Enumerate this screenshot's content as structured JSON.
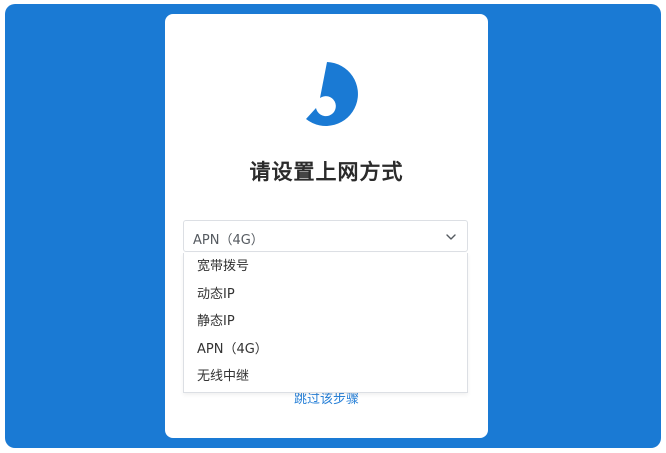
{
  "page": {
    "title": "请设置上网方式"
  },
  "connection_select": {
    "value": "APN（4G）",
    "options": [
      "宽带拨号",
      "动态IP",
      "静态IP",
      "APN（4G）",
      "无线中继"
    ]
  },
  "skip_link": "跳过该步骤",
  "colors": {
    "background": "#1a7ad4",
    "card": "#ffffff",
    "accent": "#1a7ad4",
    "link": "#2a82d8"
  },
  "icons": {
    "logo": "brand-logo-icon",
    "select_arrow": "chevron-down-icon"
  }
}
